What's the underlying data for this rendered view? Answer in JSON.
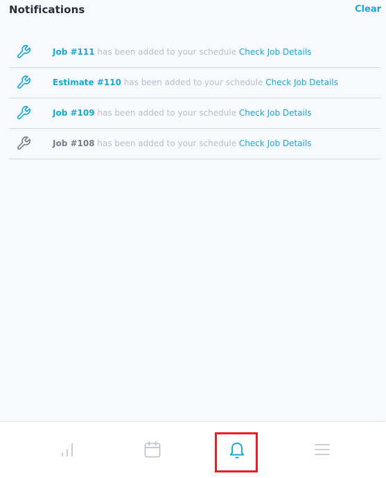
{
  "header": {
    "title": "Notifications",
    "clear_label": "Clear"
  },
  "notifications": [
    {
      "icon": "wrench-icon",
      "subject": "Job #111",
      "message": " has been added to your schedule ",
      "action": "Check Job Details",
      "read": false
    },
    {
      "icon": "wrench-icon",
      "subject": "Estimate #110",
      "message": " has been added to your schedule ",
      "action": "Check Job Details",
      "read": false
    },
    {
      "icon": "wrench-icon",
      "subject": "Job #109",
      "message": " has been added to your schedule ",
      "action": "Check Job Details",
      "read": false
    },
    {
      "icon": "wrench-icon",
      "subject": "Job #108",
      "message": " has been added to your schedule ",
      "action": "Check Job Details",
      "read": true
    }
  ],
  "tabbar": {
    "tabs": [
      {
        "icon": "bar-chart-icon",
        "active": false
      },
      {
        "icon": "calendar-icon",
        "active": false
      },
      {
        "icon": "bell-icon",
        "active": true
      },
      {
        "icon": "menu-icon",
        "active": false
      }
    ]
  },
  "colors": {
    "accent": "#17a7d4",
    "muted": "#b9bccb",
    "read_subject": "#777a88",
    "highlight": "#e11f26"
  }
}
